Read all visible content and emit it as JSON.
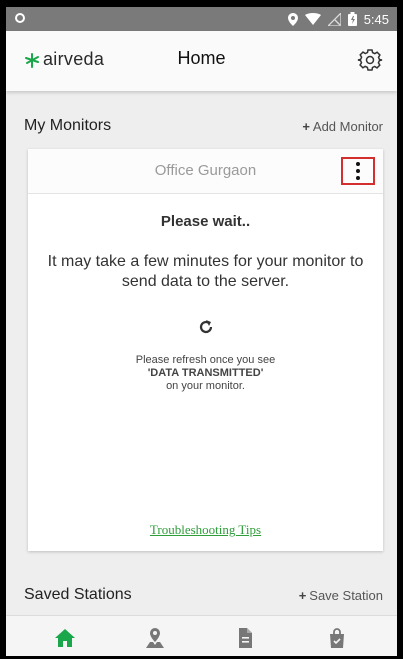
{
  "status_bar": {
    "time": "5:45"
  },
  "app_bar": {
    "logo_text": "airveda",
    "title": "Home"
  },
  "monitors_section": {
    "title": "My Monitors",
    "action_label": "Add Monitor"
  },
  "monitor_card": {
    "title": "Office Gurgaon",
    "wait_heading": "Please wait..",
    "message": "It may take a few minutes for your monitor to send data to the server.",
    "note_line1": "Please refresh once you see",
    "note_line2": "'DATA TRANSMITTED'",
    "note_line3": "on your monitor.",
    "tips_link": "Troubleshooting Tips"
  },
  "stations_section": {
    "title": "Saved Stations",
    "action_label": "Save Station"
  },
  "bottom_nav": {
    "items": [
      "home-icon",
      "map-icon",
      "document-icon",
      "shopping-bag-icon"
    ],
    "active_color": "#1aa64a",
    "inactive_color": "#777777"
  },
  "colors": {
    "accent_green": "#2e9d3a",
    "highlight_red": "#d32f2f"
  }
}
